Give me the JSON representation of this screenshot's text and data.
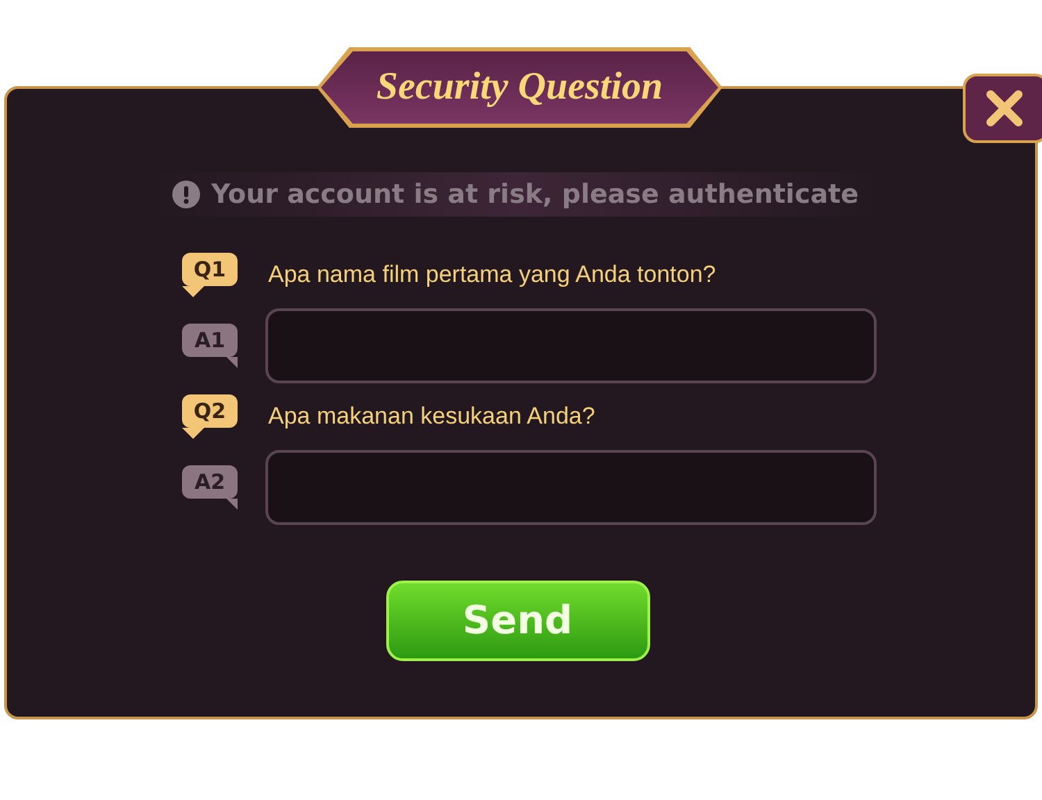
{
  "title": "Security Question",
  "notice": "Your account is at risk, please authenticate",
  "questions": [
    {
      "q_badge": "Q1",
      "question": "Apa nama film pertama yang Anda tonton?",
      "a_badge": "A1"
    },
    {
      "q_badge": "Q2",
      "question": "Apa makanan kesukaan Anda?",
      "a_badge": "A2"
    }
  ],
  "send_button": "Send"
}
